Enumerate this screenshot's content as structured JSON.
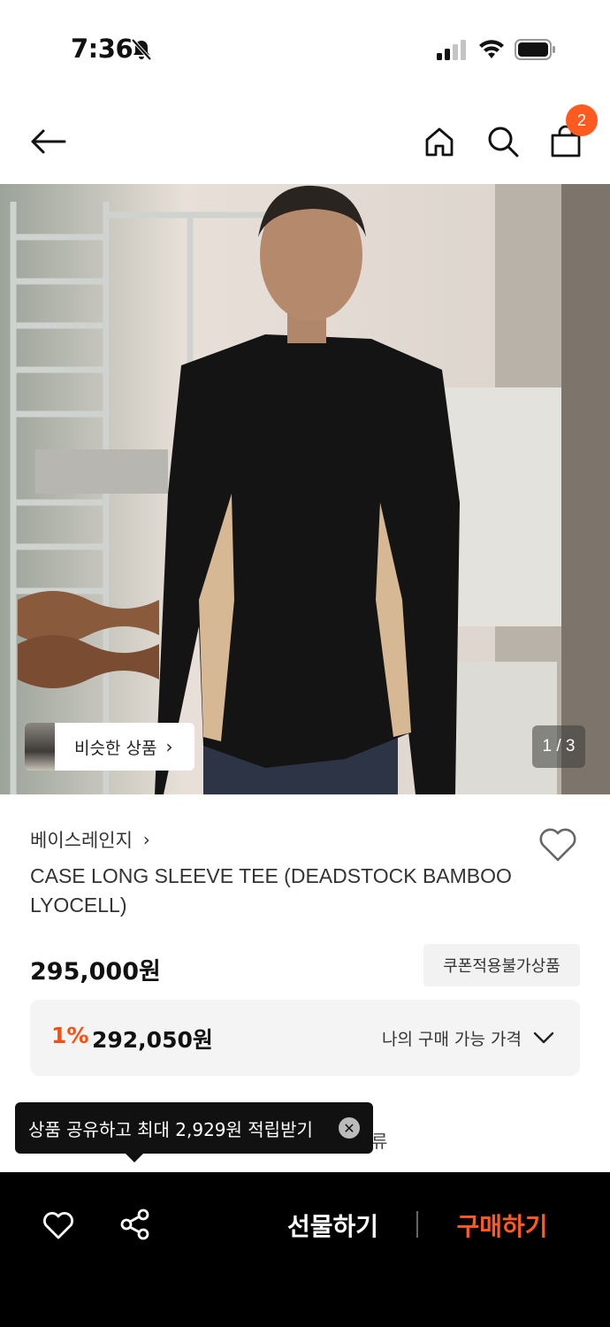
{
  "status_bar": {
    "time": "7:36"
  },
  "nav": {
    "icons": [
      "back-arrow-icon",
      "home-icon",
      "search-icon",
      "shopping-bag-icon"
    ],
    "cart_count": "2"
  },
  "image": {
    "similar_label": "비슷한 상품",
    "similar_arrow": "›",
    "page_indicator": "1 / 3"
  },
  "product": {
    "brand": "베이스레인지",
    "brand_chevron": "›",
    "title": "CASE LONG SLEEVE TEE (DEADSTOCK BAMBOO LYOCELL)",
    "price": "295,000원",
    "coupon_badge": "쿠폰적용불가상품",
    "discount_rate": "1%",
    "discount_price": "292,050원",
    "my_price_label": "나의 구매 가능 가격"
  },
  "tooltip": {
    "text": "상품 공유하고 최대 2,929원 적립받기",
    "close": "✕",
    "hidden_fragment": "류"
  },
  "bottom_bar": {
    "gift_label": "선물하기",
    "buy_label": "구매하기"
  },
  "colors": {
    "accent": "#ff5a1f",
    "discount": "#ff4d0f",
    "bottom_bar_bg": "#000000"
  }
}
